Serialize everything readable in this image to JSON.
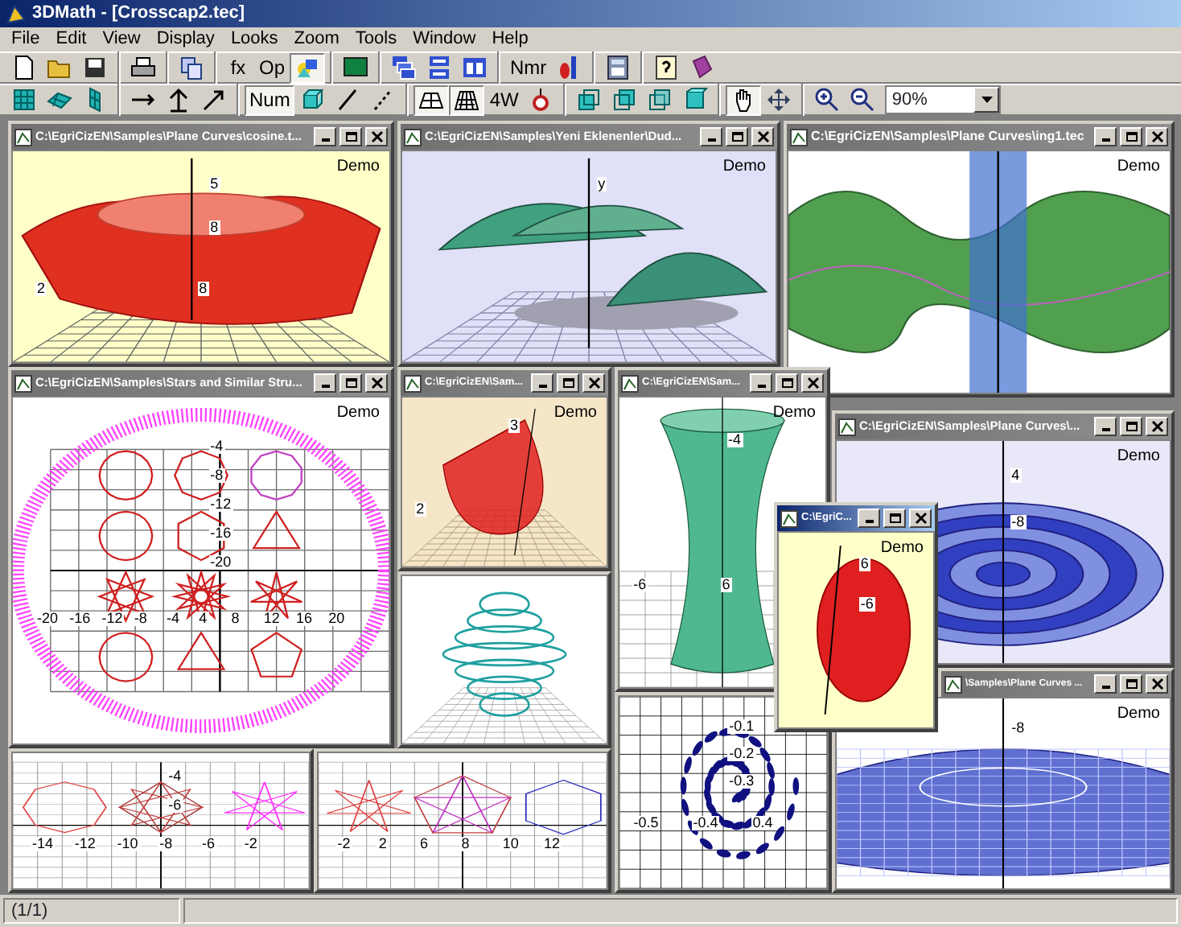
{
  "window": {
    "title": "3DMath - [Crosscap2.tec]"
  },
  "menu": [
    "File",
    "Edit",
    "View",
    "Display",
    "Looks",
    "Zoom",
    "Tools",
    "Window",
    "Help"
  ],
  "toolbars": [
    {
      "items": [
        {
          "kind": "icon",
          "pressed": false
        },
        {
          "kind": "icon",
          "pressed": false
        },
        {
          "kind": "icon",
          "pressed": false
        },
        {
          "kind": "sep"
        },
        {
          "kind": "icon",
          "pressed": false
        },
        {
          "kind": "sep"
        },
        {
          "kind": "icon",
          "pressed": false
        },
        {
          "kind": "sep"
        },
        {
          "kind": "text",
          "label": "fx",
          "pressed": false
        },
        {
          "kind": "text",
          "label": "Op",
          "pressed": false
        },
        {
          "kind": "icon",
          "pressed": true
        },
        {
          "kind": "sep"
        },
        {
          "kind": "icon",
          "pressed": false
        },
        {
          "kind": "sep"
        },
        {
          "kind": "icon",
          "pressed": false
        },
        {
          "kind": "icon",
          "pressed": false
        },
        {
          "kind": "icon",
          "pressed": false
        },
        {
          "kind": "sep"
        },
        {
          "kind": "text",
          "label": "Nmr",
          "pressed": false
        },
        {
          "kind": "icon",
          "pressed": false
        },
        {
          "kind": "sep"
        },
        {
          "kind": "icon",
          "pressed": false
        },
        {
          "kind": "sep"
        },
        {
          "kind": "icon",
          "pressed": false
        },
        {
          "kind": "icon",
          "pressed": false
        }
      ]
    },
    {
      "items": [
        {
          "kind": "icon",
          "pressed": false
        },
        {
          "kind": "icon",
          "pressed": false
        },
        {
          "kind": "icon",
          "pressed": false
        },
        {
          "kind": "sep"
        },
        {
          "kind": "icon",
          "pressed": false
        },
        {
          "kind": "icon",
          "pressed": false
        },
        {
          "kind": "icon",
          "pressed": false
        },
        {
          "kind": "sep"
        },
        {
          "kind": "text",
          "label": "Num",
          "pressed": true
        },
        {
          "kind": "icon",
          "pressed": false
        },
        {
          "kind": "icon",
          "pressed": false
        },
        {
          "kind": "icon",
          "pressed": false
        },
        {
          "kind": "sep"
        },
        {
          "kind": "icon",
          "pressed": true
        },
        {
          "kind": "icon",
          "pressed": true
        },
        {
          "kind": "text",
          "label": "4W",
          "pressed": false
        },
        {
          "kind": "icon",
          "pressed": false
        },
        {
          "kind": "sep"
        },
        {
          "kind": "icon",
          "pressed": false
        },
        {
          "kind": "icon",
          "pressed": false
        },
        {
          "kind": "icon",
          "pressed": false
        },
        {
          "kind": "icon",
          "pressed": false
        },
        {
          "kind": "sep"
        },
        {
          "kind": "icon",
          "pressed": true
        },
        {
          "kind": "icon",
          "pressed": false
        },
        {
          "kind": "sep"
        },
        {
          "kind": "icon",
          "pressed": false
        },
        {
          "kind": "icon",
          "pressed": false
        },
        {
          "kind": "combo",
          "value": "90%"
        }
      ]
    }
  ],
  "windows": [
    {
      "title": "C:\\EgriCizEN\\Samples\\Plane Curves\\cosine.t...",
      "active": false,
      "kind": "surface",
      "demo": "Demo",
      "x_ticks": [
        "2",
        "8"
      ],
      "y_ticks": [
        "5",
        "8"
      ]
    },
    {
      "title": "C:\\EgriCizEN\\Samples\\Yeni Eklenenler\\Dud...",
      "active": false,
      "kind": "umbrella",
      "demo": "Demo",
      "y_ticks": [
        "y"
      ]
    },
    {
      "title": "C:\\EgriCizEN\\Samples\\Plane Curves\\ing1.tec",
      "active": false,
      "kind": "wave",
      "demo": "Demo"
    },
    {
      "title": "C:\\EgriCizEN\\Samples\\Stars and Similar Stru...",
      "active": false,
      "kind": "stars",
      "demo": "Demo",
      "x_ticks": [
        "-20",
        "-16",
        "-12",
        "-8",
        "-4",
        "4",
        "8",
        "12",
        "16",
        "20"
      ],
      "y_ticks": [
        "-4",
        "-8",
        "-12",
        "-16",
        "-20"
      ]
    },
    {
      "title": "C:\\EgriCizEN\\Sam...",
      "active": false,
      "kind": "cone",
      "demo": "Demo",
      "x_ticks": [
        "2"
      ],
      "y_ticks": [
        "3"
      ]
    },
    {
      "title": "C:\\EgriCizEN\\Sam...",
      "active": false,
      "kind": "hyperboloid",
      "demo": "Demo",
      "x_ticks": [
        "-6",
        "6"
      ],
      "y_ticks": [
        "-4"
      ]
    },
    {
      "title": "C:\\EgriCizEN\\Samples\\Plane Curves\\...",
      "active": false,
      "kind": "ripple",
      "demo": "Demo",
      "y_ticks": [
        "4",
        "-8"
      ]
    },
    {
      "title": "\\Samples\\Plane Curves ...",
      "active": false,
      "kind": "mesh",
      "demo": "Demo",
      "y_ticks": [
        "-8"
      ]
    },
    {
      "kind": "spiral-sphere"
    },
    {
      "kind": "polygons",
      "x_ticks": [
        "-14",
        "-12",
        "-10",
        "-8",
        "-6",
        "-2"
      ],
      "y_ticks": [
        "-4",
        "-6"
      ]
    },
    {
      "kind": "star-polygons",
      "x_ticks": [
        "-2",
        "2",
        "6",
        "8",
        "10",
        "12"
      ]
    },
    {
      "kind": "spiral",
      "x_ticks": [
        "-0.5",
        "-0.4",
        "0.4"
      ],
      "y_ticks": [
        "-0.1",
        "-0.2",
        "-0.3"
      ]
    },
    {
      "title": "C:\\EgriC...",
      "active": true,
      "kind": "egg",
      "demo": "Demo",
      "y_ticks": [
        "6",
        "-6"
      ]
    }
  ],
  "status_bar": {
    "panels": [
      "(1/1)"
    ]
  }
}
